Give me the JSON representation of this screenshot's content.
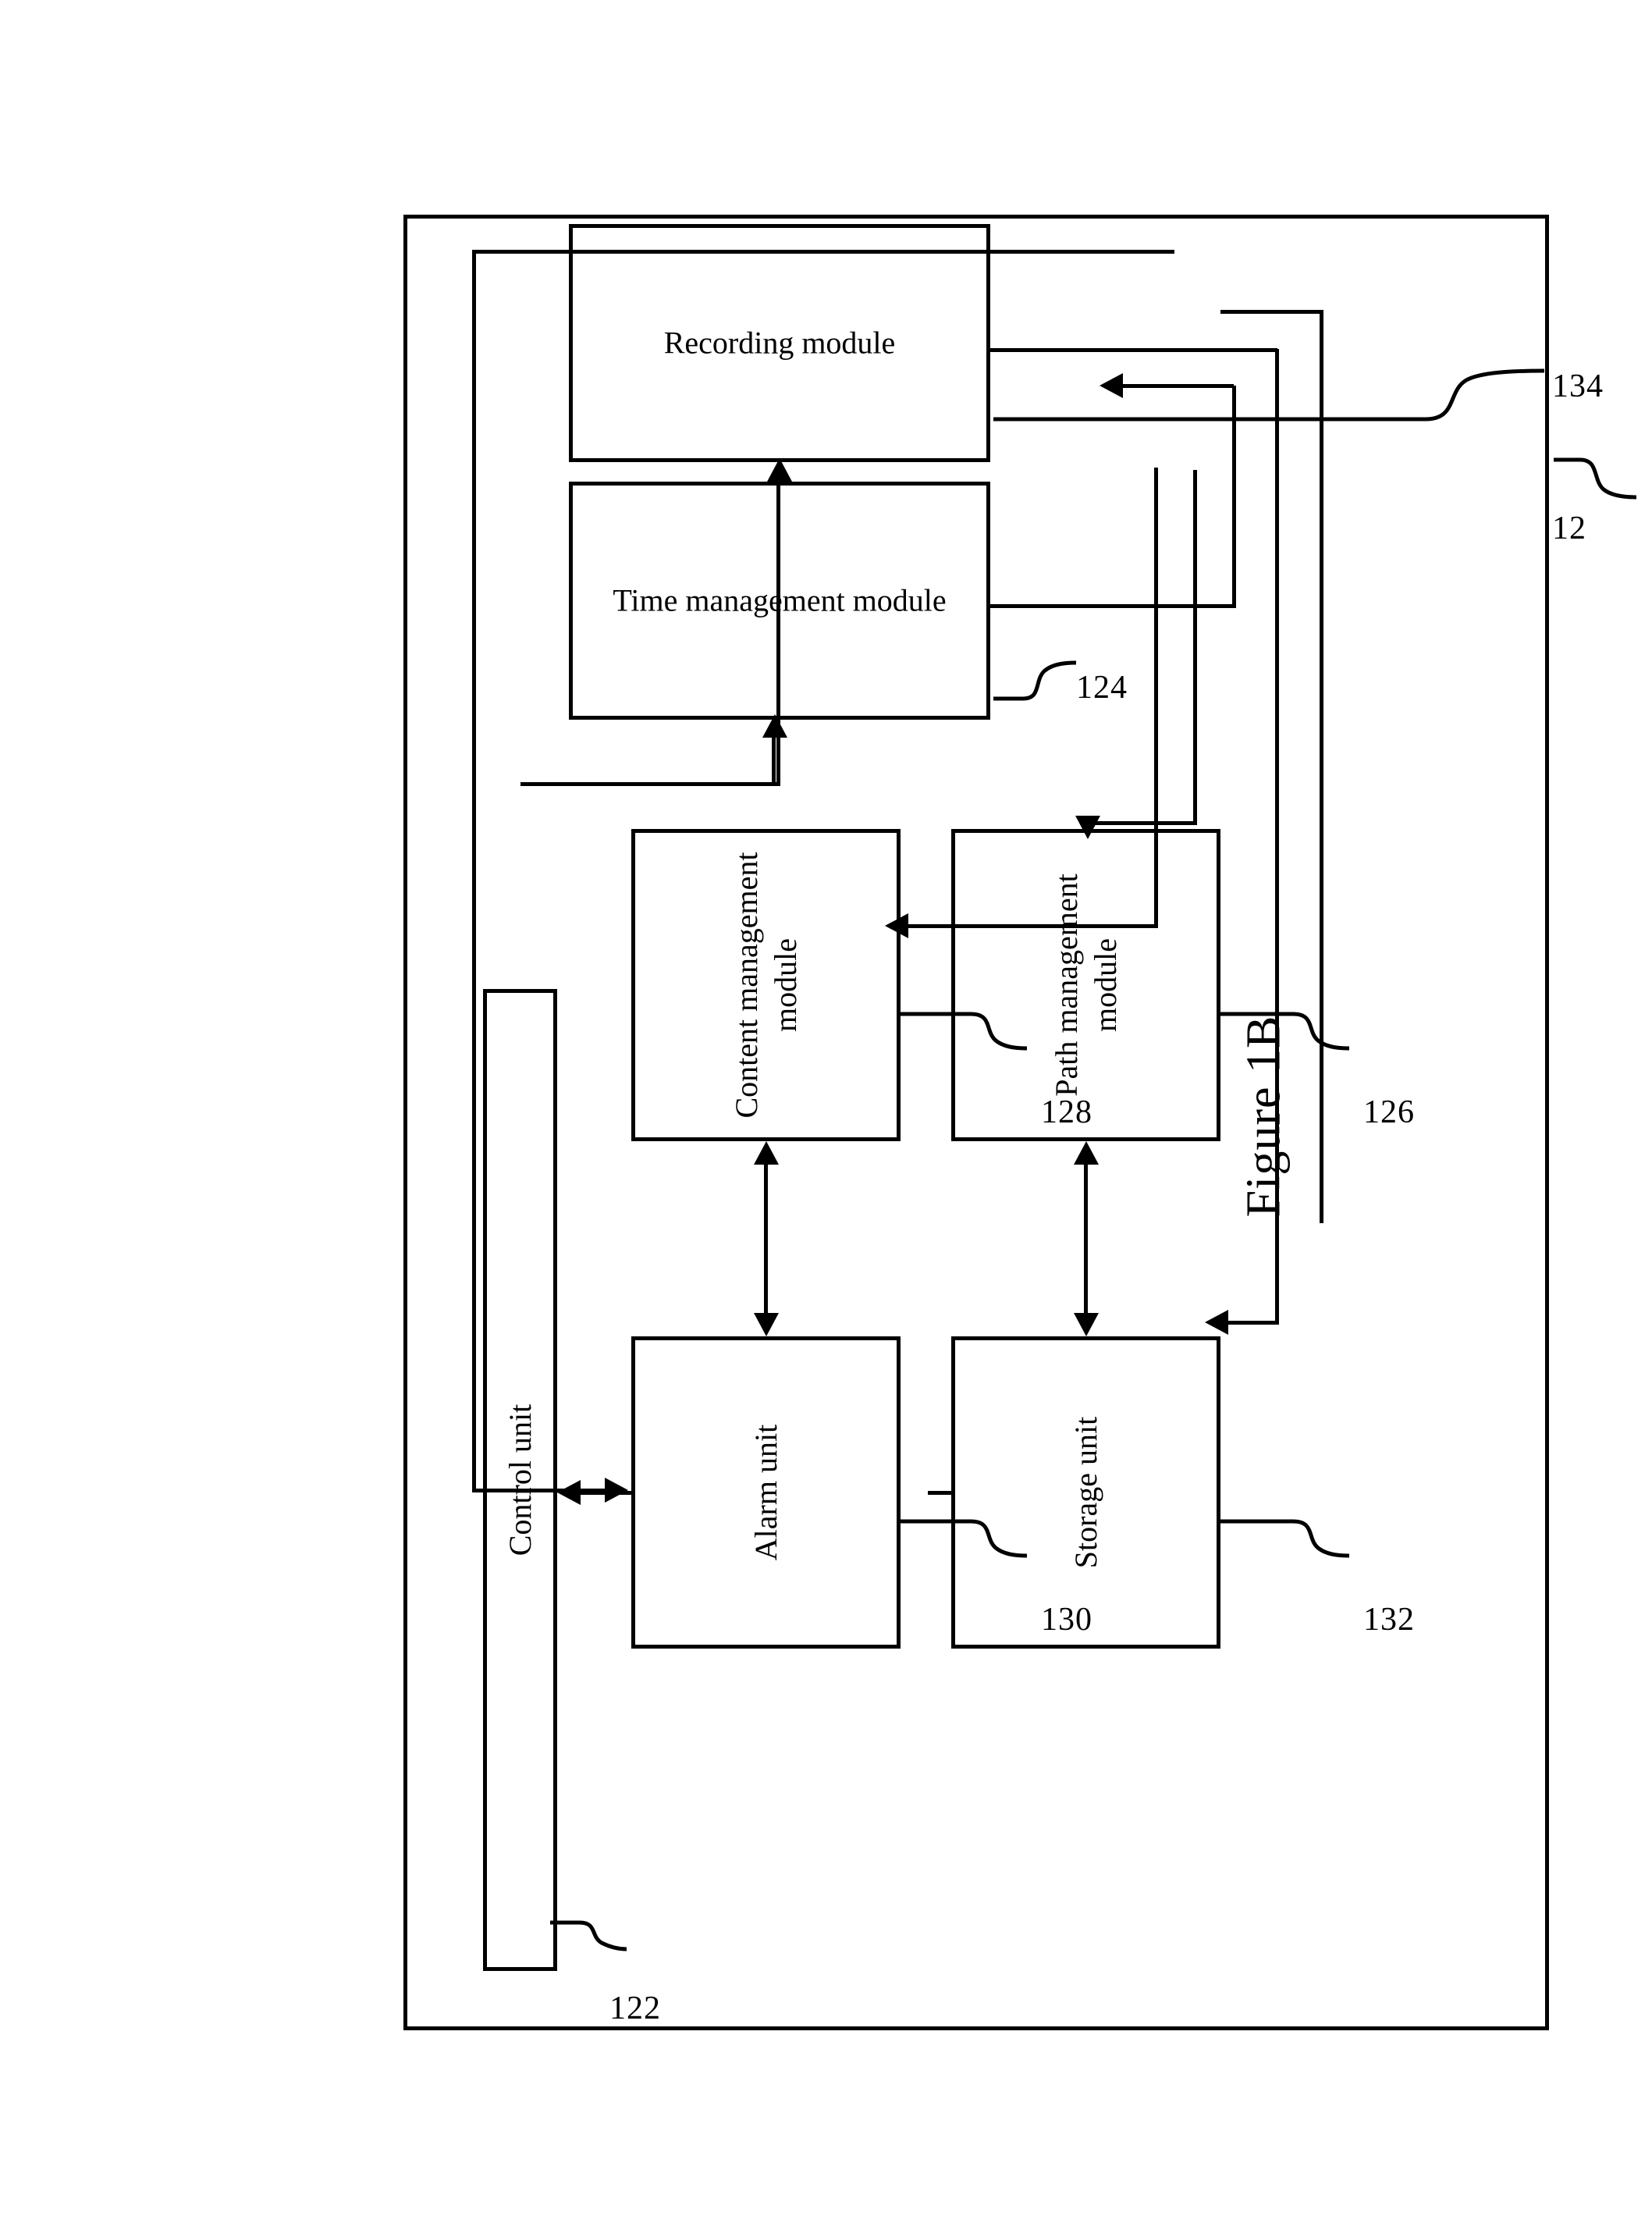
{
  "figure": {
    "caption": "Figure 1B",
    "type": "patent-block-diagram",
    "orientation": "landscape-rotated-90ccw"
  },
  "system": {
    "boundary_ref": "12",
    "boundary_name": "system boundary"
  },
  "blocks": [
    {
      "id": "control-unit",
      "label": "Control unit",
      "ref": "122"
    },
    {
      "id": "alarm-unit",
      "label": "Alarm unit",
      "ref": "130"
    },
    {
      "id": "storage-unit",
      "label": "Storage unit",
      "ref": "132"
    },
    {
      "id": "content-management-module",
      "label": "Content management\nmodule",
      "ref": "128"
    },
    {
      "id": "path-management-module",
      "label": "Path management module",
      "ref": "126"
    },
    {
      "id": "time-management-module",
      "label": "Time management module",
      "ref": "124"
    },
    {
      "id": "recording-module",
      "label": "Recording module",
      "ref": "134"
    }
  ],
  "refnums": {
    "control_unit": "122",
    "alarm_unit": "130",
    "storage_unit": "132",
    "content_management_module": "128",
    "path_management_module": "126",
    "time_management_module": "124",
    "recording_module": "134",
    "system": "12"
  },
  "connections": [
    {
      "from": "control-unit",
      "to": "alarm-unit",
      "arrow": "single"
    },
    {
      "from": "alarm-unit",
      "to": "control-unit",
      "arrow": "single"
    },
    {
      "from": "alarm-unit",
      "to": "content-management-module",
      "arrow": "double"
    },
    {
      "from": "storage-unit",
      "to": "path-management-module",
      "arrow": "double"
    },
    {
      "from": "control-unit",
      "to": "time-management-module",
      "arrow": "single"
    },
    {
      "from": "control-unit",
      "to": "recording-module",
      "arrow": "single"
    },
    {
      "from": "recording-module",
      "to": "content-management-module",
      "arrow": "single"
    },
    {
      "from": "recording-module",
      "to": "path-management-module",
      "arrow": "single"
    },
    {
      "from": "time-management-module",
      "to": "recording-module",
      "arrow": "single"
    },
    {
      "from": "time-management-module",
      "to": "storage-unit",
      "arrow": "single"
    }
  ],
  "colors": {
    "ink": "#000000",
    "paper": "#ffffff"
  }
}
